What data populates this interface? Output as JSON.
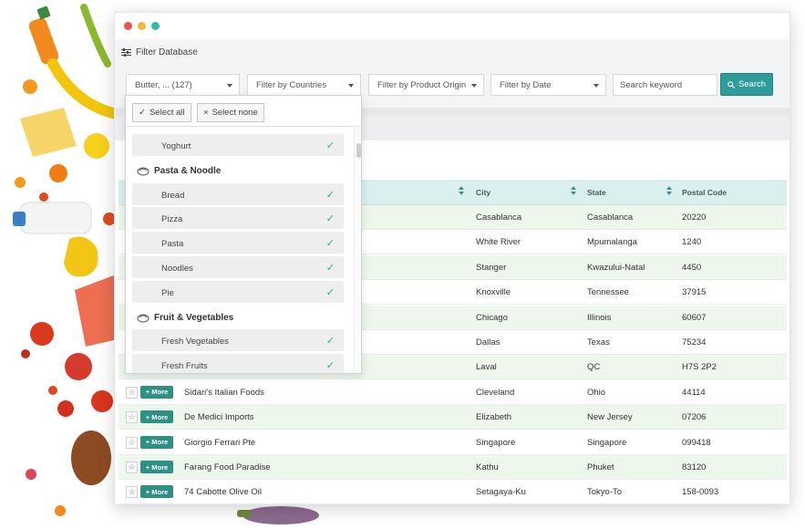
{
  "filter_header": {
    "label": "Filter Database"
  },
  "toolbar": {
    "category_select": "Butter, ... (127)",
    "countries_select": "Filter by Countries",
    "origin_select": "Filter by Product Origin",
    "date_select": "Filter by Date",
    "search_placeholder": "Search keyword",
    "search_button": "Search"
  },
  "dropdown": {
    "select_all": "Select all",
    "select_none": "Select none",
    "check_glyph": "✓",
    "items": [
      {
        "type": "item",
        "label": "Yoghurt"
      },
      {
        "type": "group",
        "label": "Pasta & Noodle",
        "icon": "pasta-bowl-icon"
      },
      {
        "type": "item",
        "label": "Bread"
      },
      {
        "type": "item",
        "label": "Pizza"
      },
      {
        "type": "item",
        "label": "Pasta"
      },
      {
        "type": "item",
        "label": "Noodles"
      },
      {
        "type": "item",
        "label": "Pie"
      },
      {
        "type": "group",
        "label": "Fruit & Vegetables",
        "icon": "vegetable-icon"
      },
      {
        "type": "item",
        "label": "Fresh Vegetables"
      },
      {
        "type": "item",
        "label": "Fresh Fruits"
      }
    ]
  },
  "table": {
    "columns": [
      "City",
      "State",
      "Postal Code"
    ],
    "more_label": "+ More",
    "star_glyph": "☆",
    "rows": [
      {
        "name": "",
        "city": "Casablanca",
        "state": "Casablanca",
        "postal": "20220"
      },
      {
        "name": "",
        "city": "White River",
        "state": "Mpumalanga",
        "postal": "1240"
      },
      {
        "name": "",
        "city": "Stanger",
        "state": "Kwazului-Natal",
        "postal": "4450"
      },
      {
        "name": "",
        "city": "Knoxville",
        "state": "Tennessee",
        "postal": "37915"
      },
      {
        "name": "",
        "city": "Chicago",
        "state": "Illinois",
        "postal": "60607"
      },
      {
        "name": "",
        "city": "Dallas",
        "state": "Texas",
        "postal": "75234"
      },
      {
        "name": "",
        "city": "Laval",
        "state": "QC",
        "postal": "H7S 2P2"
      },
      {
        "name": "Sidari's Italian Foods",
        "city": "Cleveland",
        "state": "Ohio",
        "postal": "44114"
      },
      {
        "name": "De Medici Imports",
        "city": "Elizabeth",
        "state": "New Jersey",
        "postal": "07206"
      },
      {
        "name": "Giorgio Ferrari Pte",
        "city": "Singapore",
        "state": "Singapore",
        "postal": "099418"
      },
      {
        "name": "Farang Food Paradise",
        "city": "Kathu",
        "state": "Phuket",
        "postal": "83120"
      },
      {
        "name": "74 Cabotte Olive Oil",
        "city": "Setagaya-Ku",
        "state": "Tokyo-To",
        "postal": "158-0093"
      }
    ]
  },
  "colors": {
    "accent": "#2e9c9a",
    "row_alt": "#eef7ec",
    "header": "#d9f0ef"
  }
}
